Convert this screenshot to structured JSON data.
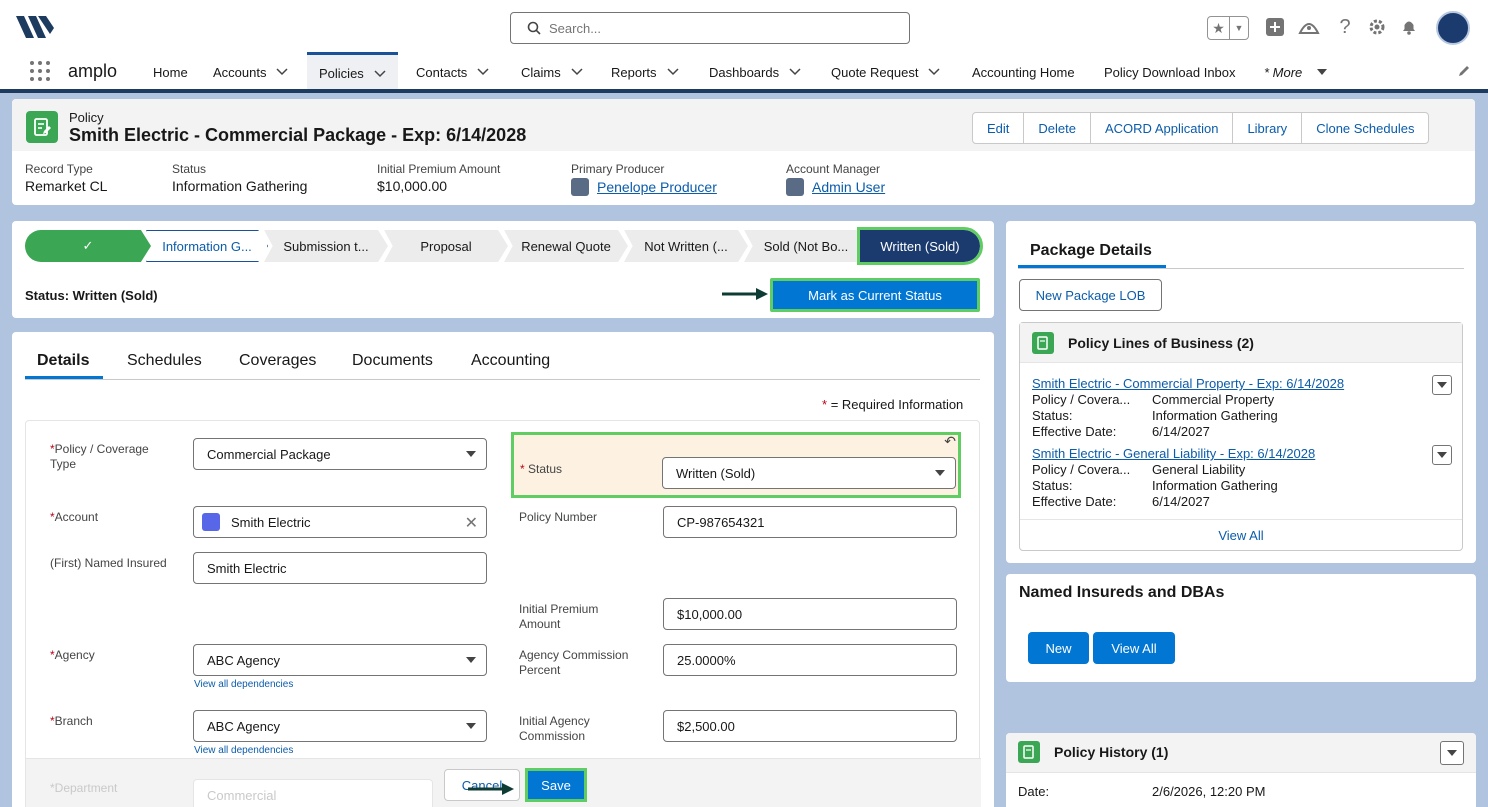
{
  "header": {
    "search_placeholder": "Search...",
    "app_name": "amplo"
  },
  "nav": {
    "items": [
      {
        "label": "Home"
      },
      {
        "label": "Accounts"
      },
      {
        "label": "Policies"
      },
      {
        "label": "Contacts"
      },
      {
        "label": "Claims"
      },
      {
        "label": "Reports"
      },
      {
        "label": "Dashboards"
      },
      {
        "label": "Quote Request"
      },
      {
        "label": "Accounting Home"
      },
      {
        "label": "Policy Download Inbox"
      },
      {
        "label": "* More"
      }
    ]
  },
  "record": {
    "type_label": "Policy",
    "title": "Smith Electric - Commercial Package - Exp: 6/14/2028",
    "actions": [
      "Edit",
      "Delete",
      "ACORD Application",
      "Library",
      "Clone Schedules"
    ],
    "highlights": [
      {
        "label": "Record Type",
        "value": "Remarket CL"
      },
      {
        "label": "Status",
        "value": "Information Gathering"
      },
      {
        "label": "Initial Premium Amount",
        "value": "$10,000.00"
      },
      {
        "label": "Primary Producer",
        "value": "Penelope Producer"
      },
      {
        "label": "Account Manager",
        "value": "Admin User"
      }
    ]
  },
  "path": {
    "stages": [
      "✓",
      "Information G...",
      "Submission t...",
      "Proposal",
      "Renewal Quote",
      "Not Written (...",
      "Sold (Not Bo...",
      "Written (Sold)"
    ],
    "status_line": "Status: Written (Sold)",
    "mark_button": "Mark as Current Status"
  },
  "tabs": [
    "Details",
    "Schedules",
    "Coverages",
    "Documents",
    "Accounting"
  ],
  "form": {
    "required_note": "= Required Information",
    "required_star": "*",
    "policy_coverage_type_label": "Policy / Coverage Type",
    "policy_coverage_type_value": "Commercial Package",
    "status_label": "Status",
    "status_value": "Written (Sold)",
    "account_label": "Account",
    "account_value": "Smith Electric",
    "policy_number_label": "Policy Number",
    "policy_number_value": "CP-987654321",
    "named_insured_label": "(First) Named Insured",
    "named_insured_value": "Smith Electric",
    "initial_premium_label": "Initial Premium Amount",
    "initial_premium_value": "$10,000.00",
    "agency_label": "Agency",
    "agency_value": "ABC Agency",
    "agency_commission_pct_label": "Agency Commission Percent",
    "agency_commission_pct_value": "25.0000%",
    "branch_label": "Branch",
    "branch_value": "ABC Agency",
    "initial_agency_commission_label": "Initial Agency Commission",
    "initial_agency_commission_value": "$2,500.00",
    "view_dependencies": "View all dependencies",
    "department_label": "Department",
    "department_value": "Commercial",
    "cancel": "Cancel",
    "save": "Save"
  },
  "package": {
    "title": "Package Details",
    "new_lob_button": "New Package LOB",
    "lob_header": "Policy Lines of Business (2)",
    "lobs": [
      {
        "name": "Smith Electric - Commercial Property - Exp: 6/14/2028",
        "type_label": "Policy / Covera...",
        "type": "Commercial Property",
        "status_label": "Status:",
        "status": "Information Gathering",
        "eff_label": "Effective Date:",
        "eff": "6/14/2027"
      },
      {
        "name": "Smith Electric - General Liability - Exp: 6/14/2028",
        "type_label": "Policy / Covera...",
        "type": "General Liability",
        "status_label": "Status:",
        "status": "Information Gathering",
        "eff_label": "Effective Date:",
        "eff": "6/14/2027"
      }
    ],
    "view_all": "View All"
  },
  "named_insureds": {
    "title": "Named Insureds and DBAs",
    "new_button": "New",
    "view_all_button": "View All"
  },
  "history": {
    "title": "Policy History (1)",
    "date_label": "Date:",
    "date_value": "2/6/2026, 12:20 PM"
  },
  "colors": {
    "brand_blue": "#0176d3",
    "highlight_green": "#5fcd62",
    "stage_complete": "#3ba755",
    "stage_current": "#1b3b6f"
  }
}
